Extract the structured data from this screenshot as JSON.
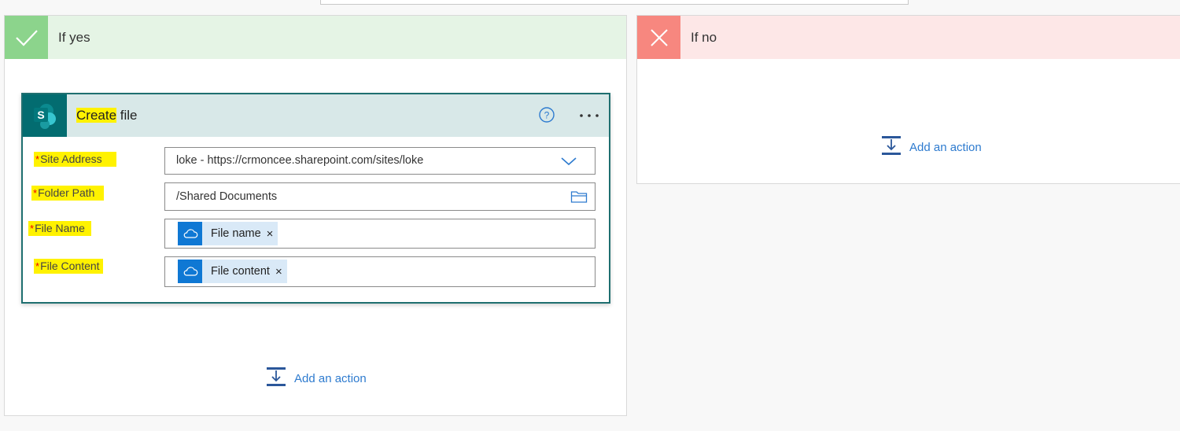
{
  "condition": {
    "yes": {
      "title": "If yes",
      "icon": "checkmark-icon",
      "header_color": "#e5f4e5",
      "icon_color": "#8cd48c",
      "card": {
        "title_highlighted": "Create",
        "title_rest": " file",
        "connector_icon": "sharepoint-icon",
        "accent_color": "#036c70",
        "help_icon": "help-icon",
        "more_icon": "more-options-icon",
        "fields": [
          {
            "label": "Site Address",
            "required": "*",
            "value": "loke - https://crmoncee.sharepoint.com/sites/loke",
            "control_icon": "chevron-down-icon"
          },
          {
            "label": "Folder Path",
            "required": "*",
            "value": "/Shared Documents",
            "control_icon": "folder-icon"
          },
          {
            "label": "File Name",
            "required": "*",
            "token": "File name",
            "token_icon": "onedrive-cloud-icon",
            "remove": "×"
          },
          {
            "label": "File Content",
            "required": "*",
            "token": "File content",
            "token_icon": "onedrive-cloud-icon",
            "remove": "×"
          }
        ]
      },
      "add_action": "Add an action"
    },
    "no": {
      "title": "If no",
      "icon": "close-icon",
      "header_color": "#fde7e7",
      "icon_color": "#f7877f",
      "add_action": "Add an action"
    }
  }
}
